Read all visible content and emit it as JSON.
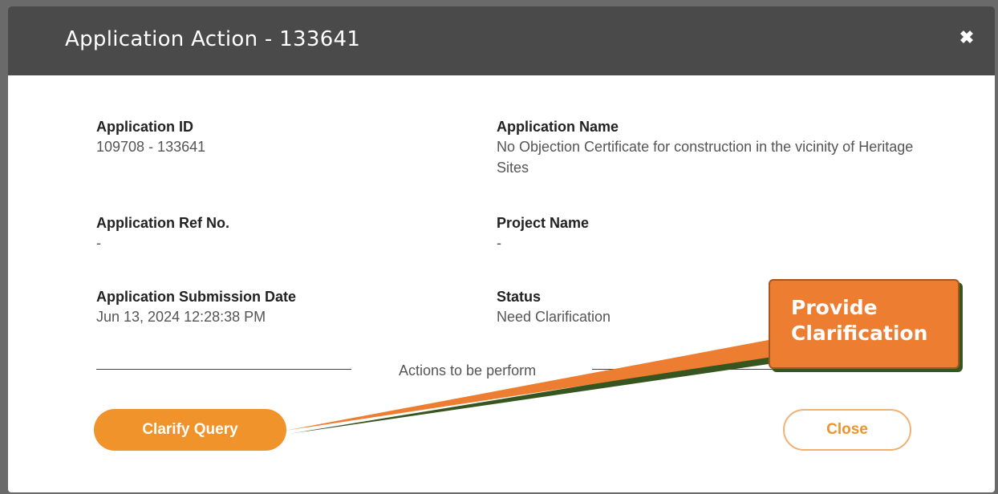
{
  "modal": {
    "title": "Application Action - 133641",
    "close_icon": "close-x-icon"
  },
  "fields": {
    "application_id": {
      "label": "Application ID",
      "value": "109708 - 133641"
    },
    "application_name": {
      "label": "Application Name",
      "value": "No Objection Certificate for construction in the vicinity of Heritage Sites"
    },
    "application_ref_no": {
      "label": "Application Ref No.",
      "value": "-"
    },
    "project_name": {
      "label": "Project Name",
      "value": "-"
    },
    "submission_date": {
      "label": "Application Submission Date",
      "value": "Jun 13, 2024 12:28:38 PM"
    },
    "status": {
      "label": "Status",
      "value": "Need Clarification"
    }
  },
  "actions": {
    "divider_text": "Actions to be perform",
    "clarify_label": "Clarify Query",
    "close_label": "Close"
  },
  "callout": {
    "text": "Provide\nClarification",
    "fill_color": "#ed7d31"
  },
  "colors": {
    "header_bg": "#4a4a4a",
    "accent": "#f0932b"
  }
}
